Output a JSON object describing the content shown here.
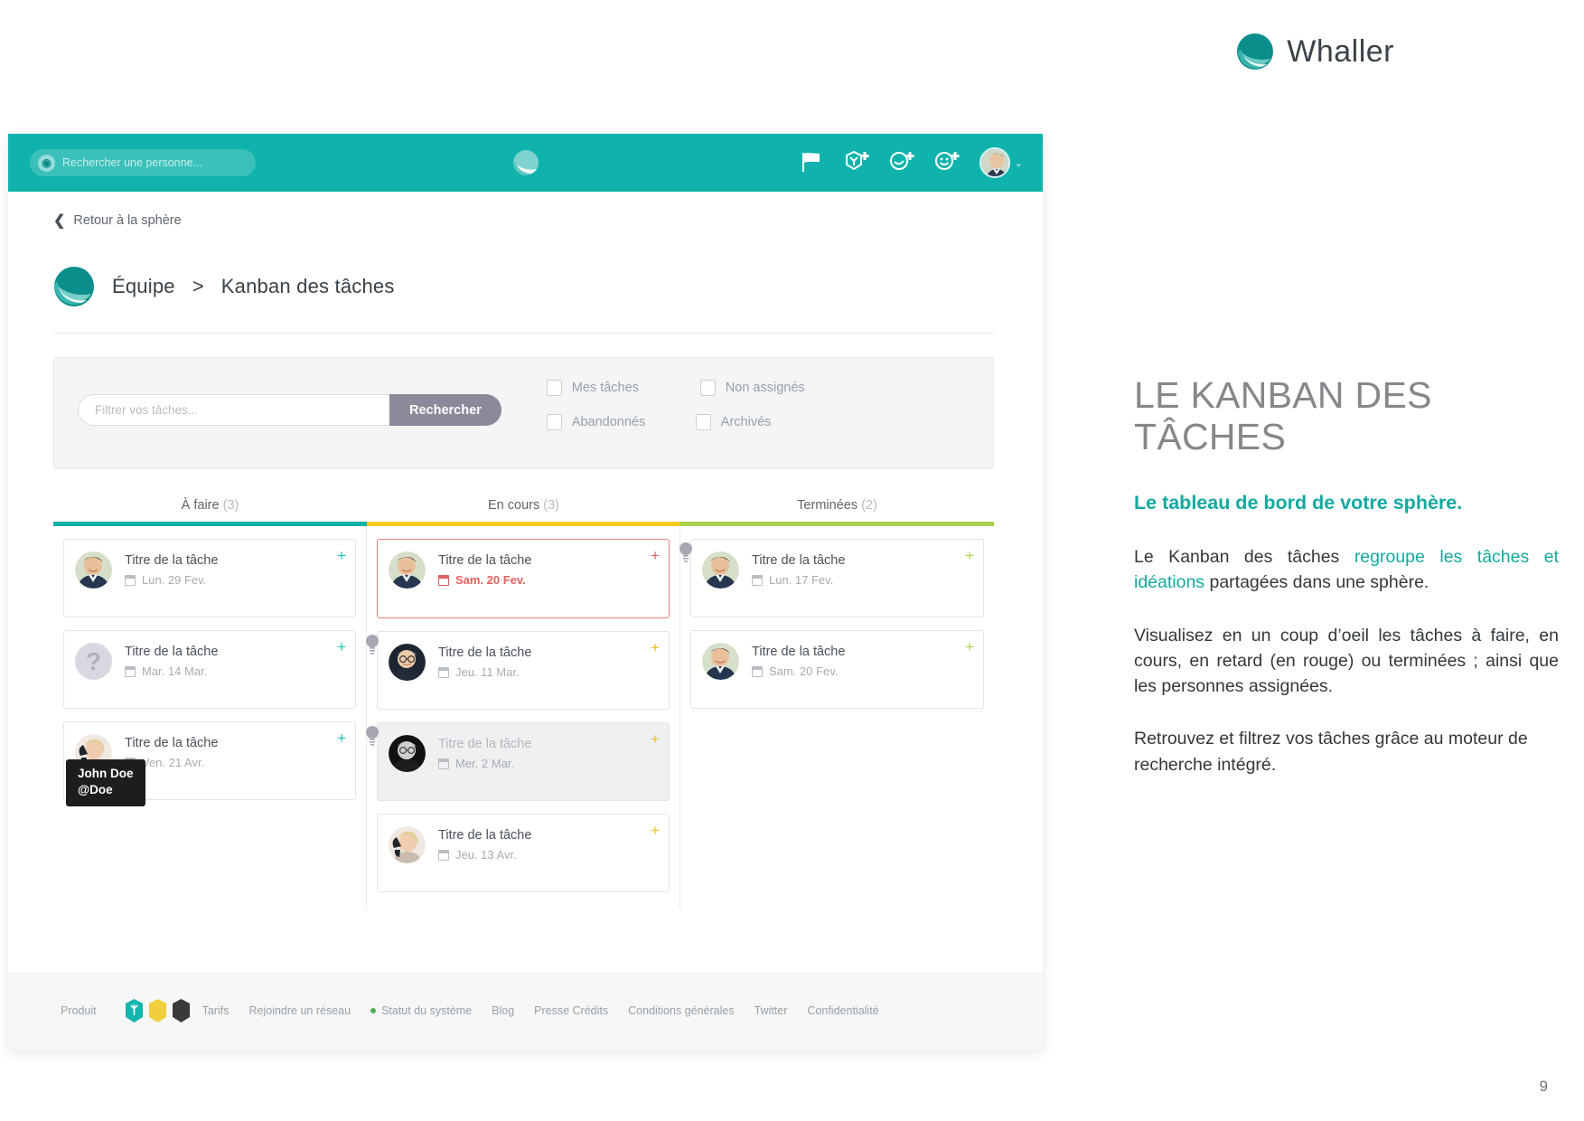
{
  "brand": {
    "name": "Whaller",
    "accent": "#0fb3ac"
  },
  "page_number": "9",
  "app": {
    "topbar": {
      "search_placeholder": "Rechercher une personne...",
      "icons": [
        {
          "name": "flag-icon"
        },
        {
          "name": "add-sphere-icon"
        },
        {
          "name": "add-network-icon"
        },
        {
          "name": "add-contact-icon"
        }
      ],
      "avatar_caret": "⌄"
    },
    "back_link": {
      "chevron": "❮",
      "label": "Retour à la sphère"
    },
    "breadcrumb": {
      "root": "Équipe",
      "separator": ">",
      "current": "Kanban des tâches"
    },
    "filters": {
      "input_placeholder": "Filtrer vos tâches...",
      "search_button": "Rechercher",
      "checkboxes": [
        {
          "label": "Mes tâches",
          "checked": false
        },
        {
          "label": "Non assignés",
          "checked": false
        },
        {
          "label": "Abandonnés",
          "checked": false
        },
        {
          "label": "Archivés",
          "checked": false
        }
      ]
    },
    "tooltip": {
      "name": "John Doe",
      "handle": "@Doe"
    },
    "kanban": {
      "columns": [
        {
          "title": "À faire",
          "count": "(3)",
          "rule_color": "#0fb3ac",
          "plus_color": "#21c1b4",
          "cards": [
            {
              "title": "Titre de la tâche",
              "date": "Lun. 29 Fev.",
              "avatar": "man-dark-hair",
              "state": "normal",
              "bulb": false,
              "plus": "+"
            },
            {
              "title": "Titre de la tâche",
              "date": "Mar. 14 Mar.",
              "avatar": "unknown",
              "state": "normal",
              "bulb": false,
              "plus": "+"
            },
            {
              "title": "Titre de la tâche",
              "date": "Ven. 21 Avr.",
              "avatar": "woman-blonde",
              "state": "normal",
              "bulb": false,
              "plus": "+"
            }
          ]
        },
        {
          "title": "En cours",
          "count": "(3)",
          "rule_color": "#f5cb1e",
          "plus_color": "#f2c31b",
          "cards": [
            {
              "title": "Titre de la tâche",
              "date": "Sam. 20 Fev.",
              "avatar": "man-dark-hair",
              "state": "overdue",
              "bulb": false,
              "plus": "+"
            },
            {
              "title": "Titre de la tâche",
              "date": "Jeu. 11 Mar.",
              "avatar": "man-glasses",
              "state": "normal",
              "bulb": true,
              "plus": "+"
            },
            {
              "title": "Titre de la tâche",
              "date": "Mer. 2 Mar.",
              "avatar": "man-glasses-bw",
              "state": "muted",
              "bulb": true,
              "plus": "+"
            },
            {
              "title": "Titre de la tâche",
              "date": "Jeu. 13 Avr.",
              "avatar": "woman-blonde",
              "state": "normal",
              "bulb": false,
              "plus": "+"
            }
          ]
        },
        {
          "title": "Terminées",
          "count": "(2)",
          "rule_color": "#a7cf4c",
          "plus_color": "#a7cf4c",
          "cards": [
            {
              "title": "Titre de la tâche",
              "date": "Lun. 17 Fev.",
              "avatar": "man-dark-hair",
              "state": "normal",
              "bulb": true,
              "plus": "+"
            },
            {
              "title": "Titre de la tâche",
              "date": "Sam. 20 Fev.",
              "avatar": "man-dark-hair",
              "state": "normal",
              "bulb": false,
              "plus": "+"
            }
          ]
        }
      ]
    },
    "footer": {
      "produit_label": "Produit",
      "links": [
        "Tarifs",
        "Rejoindre un réseau",
        "Statut du système",
        "Blog",
        "Presse Crédits",
        "Conditions générales",
        "Twitter",
        "Confidentialité"
      ],
      "status_dot_color": "#4caf50"
    }
  },
  "sidepanel": {
    "title": "LE KANBAN DES TÂCHES",
    "lead": "Le tableau de bord de votre sphère.",
    "p1_a": "Le Kanban des tâches ",
    "p1_hl": "regroupe les tâches et idéations",
    "p1_b": " partagées dans une sphère.",
    "p2": "Visualisez en un coup d’oeil les tâches à faire, en cours, en retard (en rouge) ou terminées ; ainsi que les personnes assignées.",
    "p3": "Retrouvez et filtrez vos tâches grâce au moteur de recherche intégré."
  }
}
